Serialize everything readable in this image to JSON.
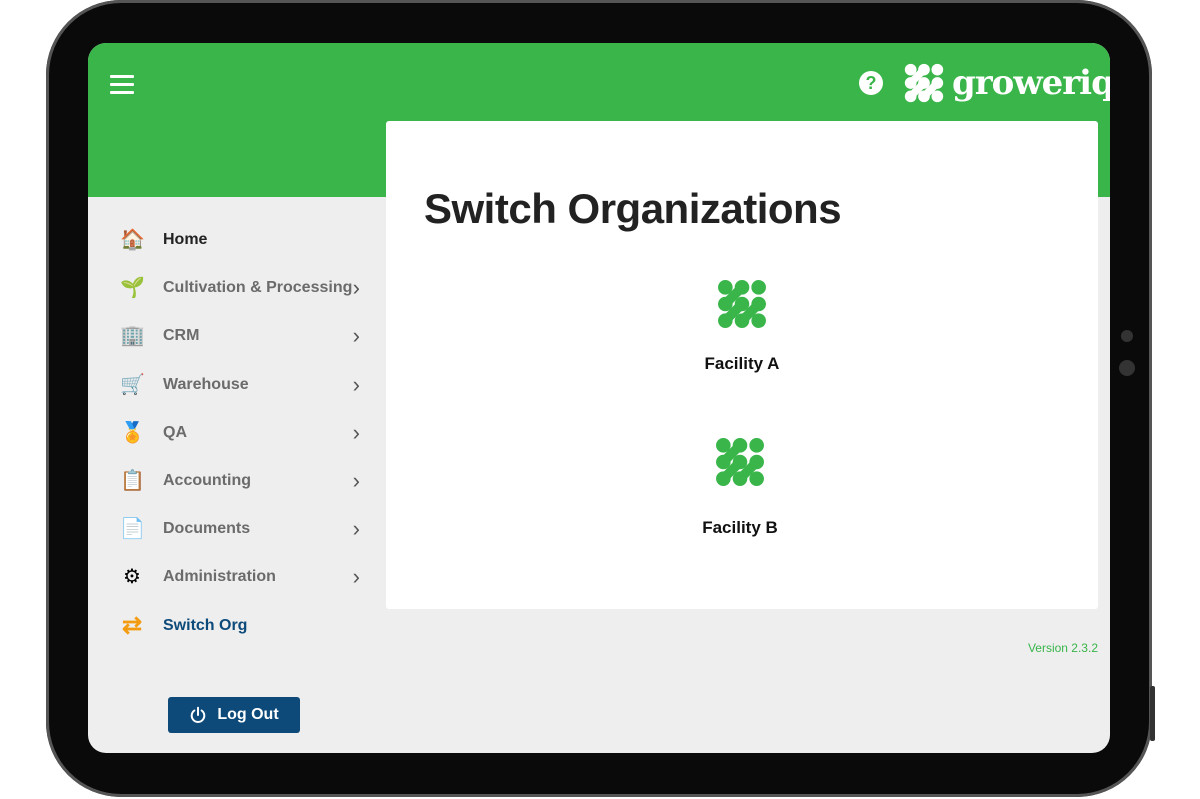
{
  "header": {
    "help_icon": "question-circle-icon",
    "logo_text": "groweriq",
    "accent": "#39b54a"
  },
  "sidebar": {
    "items": [
      {
        "label": "Home",
        "icon": "house-icon",
        "chevron": false,
        "color": "#222222"
      },
      {
        "label": "Cultivation & Processing",
        "icon": "plant-icon",
        "chevron": true,
        "color": "#6b6b6b"
      },
      {
        "label": "CRM",
        "icon": "contacts-icon",
        "chevron": true,
        "color": "#6b6b6b"
      },
      {
        "label": "Warehouse",
        "icon": "cart-icon",
        "chevron": true,
        "color": "#6b6b6b"
      },
      {
        "label": "QA",
        "icon": "award-icon",
        "chevron": true,
        "color": "#6b6b6b"
      },
      {
        "label": "Accounting",
        "icon": "clipboard-icon",
        "chevron": true,
        "color": "#6b6b6b"
      },
      {
        "label": "Documents",
        "icon": "document-icon",
        "chevron": true,
        "color": "#6b6b6b"
      },
      {
        "label": "Administration",
        "icon": "gears-icon",
        "chevron": true,
        "color": "#6b6b6b"
      },
      {
        "label": "Switch Org",
        "icon": "swap-arrows-icon",
        "chevron": false,
        "color": "#0d4a7a"
      }
    ],
    "logout_label": "Log Out"
  },
  "main": {
    "title": "Switch Organizations",
    "facilities": [
      {
        "name": "Facility A"
      },
      {
        "name": "Facility B"
      }
    ]
  },
  "version": "Version 2.3.2"
}
